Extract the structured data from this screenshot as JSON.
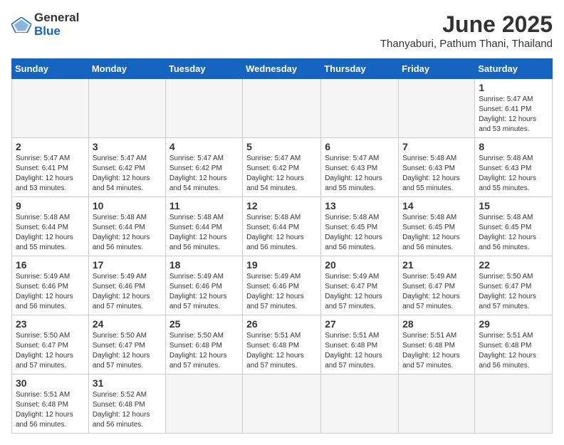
{
  "header": {
    "logo_general": "General",
    "logo_blue": "Blue",
    "title": "June 2025",
    "subtitle": "Thanyaburi, Pathum Thani, Thailand"
  },
  "calendar": {
    "days_of_week": [
      "Sunday",
      "Monday",
      "Tuesday",
      "Wednesday",
      "Thursday",
      "Friday",
      "Saturday"
    ],
    "weeks": [
      [
        null,
        null,
        null,
        null,
        null,
        null,
        {
          "day": "1",
          "sunrise": "Sunrise: 5:47 AM",
          "sunset": "Sunset: 6:41 PM",
          "daylight": "Daylight: 12 hours and 53 minutes."
        }
      ],
      [
        {
          "day": "2",
          "sunrise": "Sunrise: 5:47 AM",
          "sunset": "Sunset: 6:41 PM",
          "daylight": "Daylight: 12 hours and 53 minutes."
        },
        {
          "day": "3",
          "sunrise": "Sunrise: 5:47 AM",
          "sunset": "Sunset: 6:42 PM",
          "daylight": "Daylight: 12 hours and 54 minutes."
        },
        {
          "day": "4",
          "sunrise": "Sunrise: 5:47 AM",
          "sunset": "Sunset: 6:42 PM",
          "daylight": "Daylight: 12 hours and 54 minutes."
        },
        {
          "day": "5",
          "sunrise": "Sunrise: 5:47 AM",
          "sunset": "Sunset: 6:42 PM",
          "daylight": "Daylight: 12 hours and 54 minutes."
        },
        {
          "day": "6",
          "sunrise": "Sunrise: 5:47 AM",
          "sunset": "Sunset: 6:43 PM",
          "daylight": "Daylight: 12 hours and 55 minutes."
        },
        {
          "day": "7",
          "sunrise": "Sunrise: 5:48 AM",
          "sunset": "Sunset: 6:43 PM",
          "daylight": "Daylight: 12 hours and 55 minutes."
        },
        {
          "day": "8",
          "sunrise": "Sunrise: 5:48 AM",
          "sunset": "Sunset: 6:43 PM",
          "daylight": "Daylight: 12 hours and 55 minutes."
        }
      ],
      [
        {
          "day": "9",
          "sunrise": "Sunrise: 5:48 AM",
          "sunset": "Sunset: 6:44 PM",
          "daylight": "Daylight: 12 hours and 55 minutes."
        },
        {
          "day": "10",
          "sunrise": "Sunrise: 5:48 AM",
          "sunset": "Sunset: 6:44 PM",
          "daylight": "Daylight: 12 hours and 56 minutes."
        },
        {
          "day": "11",
          "sunrise": "Sunrise: 5:48 AM",
          "sunset": "Sunset: 6:44 PM",
          "daylight": "Daylight: 12 hours and 56 minutes."
        },
        {
          "day": "12",
          "sunrise": "Sunrise: 5:48 AM",
          "sunset": "Sunset: 6:44 PM",
          "daylight": "Daylight: 12 hours and 56 minutes."
        },
        {
          "day": "13",
          "sunrise": "Sunrise: 5:48 AM",
          "sunset": "Sunset: 6:45 PM",
          "daylight": "Daylight: 12 hours and 56 minutes."
        },
        {
          "day": "14",
          "sunrise": "Sunrise: 5:48 AM",
          "sunset": "Sunset: 6:45 PM",
          "daylight": "Daylight: 12 hours and 56 minutes."
        },
        {
          "day": "15",
          "sunrise": "Sunrise: 5:48 AM",
          "sunset": "Sunset: 6:45 PM",
          "daylight": "Daylight: 12 hours and 56 minutes."
        }
      ],
      [
        {
          "day": "16",
          "sunrise": "Sunrise: 5:49 AM",
          "sunset": "Sunset: 6:46 PM",
          "daylight": "Daylight: 12 hours and 56 minutes."
        },
        {
          "day": "17",
          "sunrise": "Sunrise: 5:49 AM",
          "sunset": "Sunset: 6:46 PM",
          "daylight": "Daylight: 12 hours and 57 minutes."
        },
        {
          "day": "18",
          "sunrise": "Sunrise: 5:49 AM",
          "sunset": "Sunset: 6:46 PM",
          "daylight": "Daylight: 12 hours and 57 minutes."
        },
        {
          "day": "19",
          "sunrise": "Sunrise: 5:49 AM",
          "sunset": "Sunset: 6:46 PM",
          "daylight": "Daylight: 12 hours and 57 minutes."
        },
        {
          "day": "20",
          "sunrise": "Sunrise: 5:49 AM",
          "sunset": "Sunset: 6:47 PM",
          "daylight": "Daylight: 12 hours and 57 minutes."
        },
        {
          "day": "21",
          "sunrise": "Sunrise: 5:49 AM",
          "sunset": "Sunset: 6:47 PM",
          "daylight": "Daylight: 12 hours and 57 minutes."
        },
        {
          "day": "22",
          "sunrise": "Sunrise: 5:50 AM",
          "sunset": "Sunset: 6:47 PM",
          "daylight": "Daylight: 12 hours and 57 minutes."
        }
      ],
      [
        {
          "day": "23",
          "sunrise": "Sunrise: 5:50 AM",
          "sunset": "Sunset: 6:47 PM",
          "daylight": "Daylight: 12 hours and 57 minutes."
        },
        {
          "day": "24",
          "sunrise": "Sunrise: 5:50 AM",
          "sunset": "Sunset: 6:47 PM",
          "daylight": "Daylight: 12 hours and 57 minutes."
        },
        {
          "day": "25",
          "sunrise": "Sunrise: 5:50 AM",
          "sunset": "Sunset: 6:48 PM",
          "daylight": "Daylight: 12 hours and 57 minutes."
        },
        {
          "day": "26",
          "sunrise": "Sunrise: 5:51 AM",
          "sunset": "Sunset: 6:48 PM",
          "daylight": "Daylight: 12 hours and 57 minutes."
        },
        {
          "day": "27",
          "sunrise": "Sunrise: 5:51 AM",
          "sunset": "Sunset: 6:48 PM",
          "daylight": "Daylight: 12 hours and 57 minutes."
        },
        {
          "day": "28",
          "sunrise": "Sunrise: 5:51 AM",
          "sunset": "Sunset: 6:48 PM",
          "daylight": "Daylight: 12 hours and 57 minutes."
        },
        {
          "day": "29",
          "sunrise": "Sunrise: 5:51 AM",
          "sunset": "Sunset: 6:48 PM",
          "daylight": "Daylight: 12 hours and 56 minutes."
        }
      ],
      [
        {
          "day": "30",
          "sunrise": "Sunrise: 5:51 AM",
          "sunset": "Sunset: 6:48 PM",
          "daylight": "Daylight: 12 hours and 56 minutes."
        },
        {
          "day": "31",
          "sunrise": "Sunrise: 5:52 AM",
          "sunset": "Sunset: 6:48 PM",
          "daylight": "Daylight: 12 hours and 56 minutes."
        },
        null,
        null,
        null,
        null,
        null
      ]
    ]
  }
}
